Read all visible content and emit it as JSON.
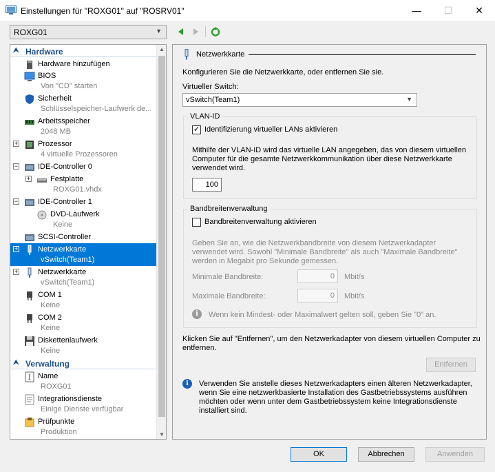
{
  "window": {
    "title": "Einstellungen für \"ROXG01\" auf \"ROSRV01\"",
    "minimize": "—",
    "maximize": "☐",
    "close": "✕"
  },
  "vm_selector": {
    "value": "ROXG01"
  },
  "tree": {
    "hardware_header": "Hardware",
    "management_header": "Verwaltung",
    "items": [
      {
        "label": "Hardware hinzufügen",
        "sub": "",
        "icon": "add-hardware-icon"
      },
      {
        "label": "BIOS",
        "sub": "Von \"CD\" starten",
        "icon": "bios-icon"
      },
      {
        "label": "Sicherheit",
        "sub": "Schlüsselspeicher-Laufwerk de...",
        "icon": "security-shield-icon"
      },
      {
        "label": "Arbeitsspeicher",
        "sub": "2048 MB",
        "icon": "memory-icon"
      },
      {
        "label": "Prozessor",
        "sub": "4 virtuelle Prozessoren",
        "icon": "processor-icon"
      },
      {
        "label": "IDE-Controller 0",
        "sub": "",
        "icon": "ide-controller-icon"
      },
      {
        "label": "Festplatte",
        "sub": "ROXG01.vhdx",
        "icon": "hard-disk-icon"
      },
      {
        "label": "IDE-Controller 1",
        "sub": "",
        "icon": "ide-controller-icon"
      },
      {
        "label": "DVD-Laufwerk",
        "sub": "Keine",
        "icon": "dvd-drive-icon"
      },
      {
        "label": "SCSI-Controller",
        "sub": "",
        "icon": "scsi-controller-icon"
      },
      {
        "label": "Netzwerkkarte",
        "sub": "vSwitch(Team1)",
        "icon": "network-adapter-icon"
      },
      {
        "label": "Netzwerkkarte",
        "sub": "vSwitch(Team1)",
        "icon": "network-adapter-icon"
      },
      {
        "label": "COM 1",
        "sub": "Keine",
        "icon": "com-port-icon"
      },
      {
        "label": "COM 2",
        "sub": "Keine",
        "icon": "com-port-icon"
      },
      {
        "label": "Diskettenlaufwerk",
        "sub": "Keine",
        "icon": "floppy-drive-icon"
      }
    ],
    "management_items": [
      {
        "label": "Name",
        "sub": "ROXG01",
        "icon": "name-icon"
      },
      {
        "label": "Integrationsdienste",
        "sub": "Einige Dienste verfügbar",
        "icon": "integration-services-icon"
      },
      {
        "label": "Prüfpunkte",
        "sub": "Produktion",
        "icon": "checkpoints-icon"
      }
    ]
  },
  "panel": {
    "header": "Netzwerkkarte",
    "intro": "Konfigurieren Sie die Netzwerkkarte, oder entfernen Sie sie.",
    "switch_label": "Virtueller Switch:",
    "switch_value": "vSwitch(Team1)",
    "vlan": {
      "title": "VLAN-ID",
      "checkbox_label": "Identifizierung virtueller LANs aktivieren",
      "checked": true,
      "description_lines": [
        "Mithilfe der VLAN-ID wird das virtuelle LAN angegeben, das von diesem virtuellen",
        "Computer für die gesamte Netzwerkkommunikation über diese Netzwerkkarte",
        "verwendet wird."
      ],
      "value": "100"
    },
    "bandwidth": {
      "title": "Bandbreitenverwaltung",
      "checkbox_label": "Bandbreitenverwaltung aktivieren",
      "checked": false,
      "description_lines": [
        "Geben Sie an, wie die Netzwerkbandbreite von diesem Netzwerkadapter",
        "verwendet wird. Sowohl \"Minimale Bandbreite\" als auch \"Maximale Bandbreite\"",
        "werden in Megabit pro Sekunde gemessen."
      ],
      "min_label": "Minimale Bandbreite:",
      "min_value": "0",
      "max_label": "Maximale Bandbreite:",
      "max_value": "0",
      "unit": "Mbit/s",
      "hint": "Wenn kein Mindest- oder Maximalwert gelten soll, geben Sie \"0\" an."
    },
    "remove_text_lines": [
      "Klicken Sie auf \"Entfernen\", um den Netzwerkadapter von diesem virtuellen Computer zu",
      "entfernen."
    ],
    "remove_button": "Entfernen",
    "legacy_info_lines": [
      "Verwenden Sie anstelle dieses Netzwerkadapters einen älteren Netzwerkadapter,",
      "wenn Sie eine netzwerkbasierte Installation des Gastbetriebssystems ausführen",
      "möchten oder wenn unter dem Gastbetriebssystem keine Integrationsdienste",
      "installiert sind."
    ]
  },
  "footer": {
    "ok": "OK",
    "cancel": "Abbrechen",
    "apply": "Anwenden"
  },
  "colors": {
    "selection": "#0078d7",
    "section_header": "#1a4e8c",
    "back_arrow": "#2e9e2e",
    "refresh": "#2e9e2e",
    "info_icon_blue": "#1a5fb4",
    "info_icon_grey": "#9a9a9a"
  }
}
